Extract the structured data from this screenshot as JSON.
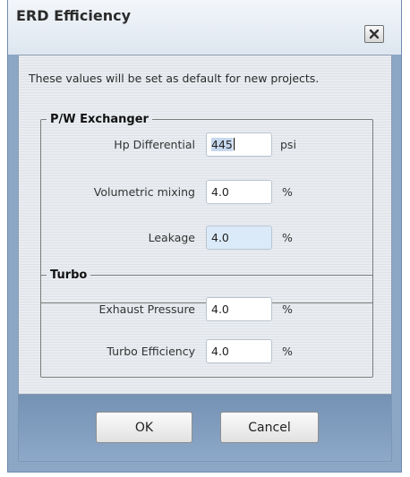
{
  "dialog": {
    "title": "ERD Efficiency",
    "close_icon": "close-x-icon",
    "note": "These values will be set as default for new projects.",
    "pw_exchanger": {
      "legend": "P/W Exchanger",
      "hp_differential": {
        "label": "Hp Differential",
        "value": "445",
        "unit": "psi"
      },
      "volumetric_mixing": {
        "label": "Volumetric mixing",
        "value": "4.0",
        "unit": "%"
      },
      "leakage": {
        "label": "Leakage",
        "value": "4.0",
        "unit": "%"
      }
    },
    "turbo": {
      "legend": "Turbo",
      "exhaust_pressure": {
        "label": "Exhaust Pressure",
        "value": "4.0",
        "unit": "%"
      },
      "turbo_efficiency": {
        "label": "Turbo Efficiency",
        "value": "4.0",
        "unit": "%"
      }
    },
    "buttons": {
      "ok": "OK",
      "cancel": "Cancel"
    }
  }
}
